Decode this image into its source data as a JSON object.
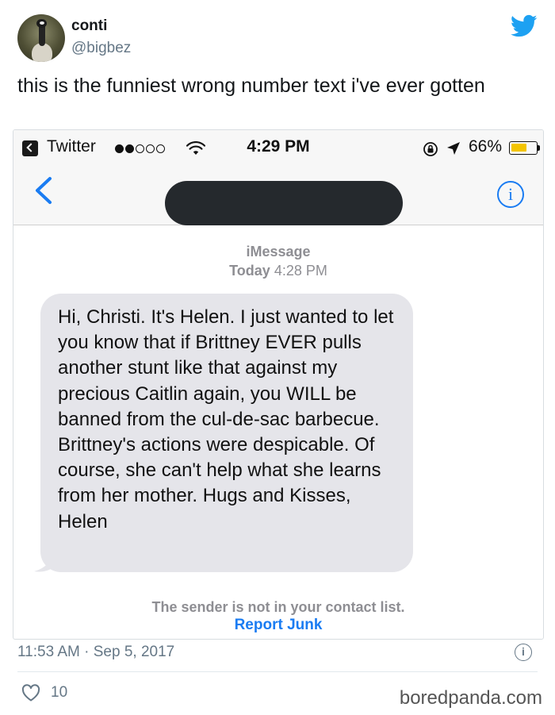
{
  "author": {
    "display_name": "conti",
    "handle": "@bigbez",
    "avatar": "goose-avatar"
  },
  "tweet": {
    "text": "this is the funniest wrong number text i've ever gotten",
    "timestamp": "11:53 AM · Sep 5, 2017",
    "likes": "10"
  },
  "brand": {
    "logo": "twitter-bird-icon",
    "twitter_blue": "#1da1f2"
  },
  "phone": {
    "status": {
      "back_app": "Twitter",
      "time": "4:29 PM",
      "battery": "66%",
      "battery_level": 0.66,
      "signal_bars_on": 2,
      "signal_bars_total": 5
    },
    "conversation": {
      "service": "iMessage",
      "day": "Today",
      "time": "4:28 PM",
      "message": "Hi, Christi. It's Helen. I just wanted to let you know that if Brittney EVER pulls another stunt like that against my precious Caitlin again, you WILL be banned from the cul-de-sac barbecue. Brittney's actions were despicable. Of course, she can't help what she learns from her mother. Hugs and Kisses, Helen",
      "contact_notice": "The sender is not in your contact list.",
      "report_label": "Report Junk"
    },
    "colors": {
      "ios_blue": "#1a7cf2",
      "bubble_gray": "#e5e5ea",
      "battery_yellow": "#f3c400"
    }
  },
  "watermark": "boredpanda.com"
}
